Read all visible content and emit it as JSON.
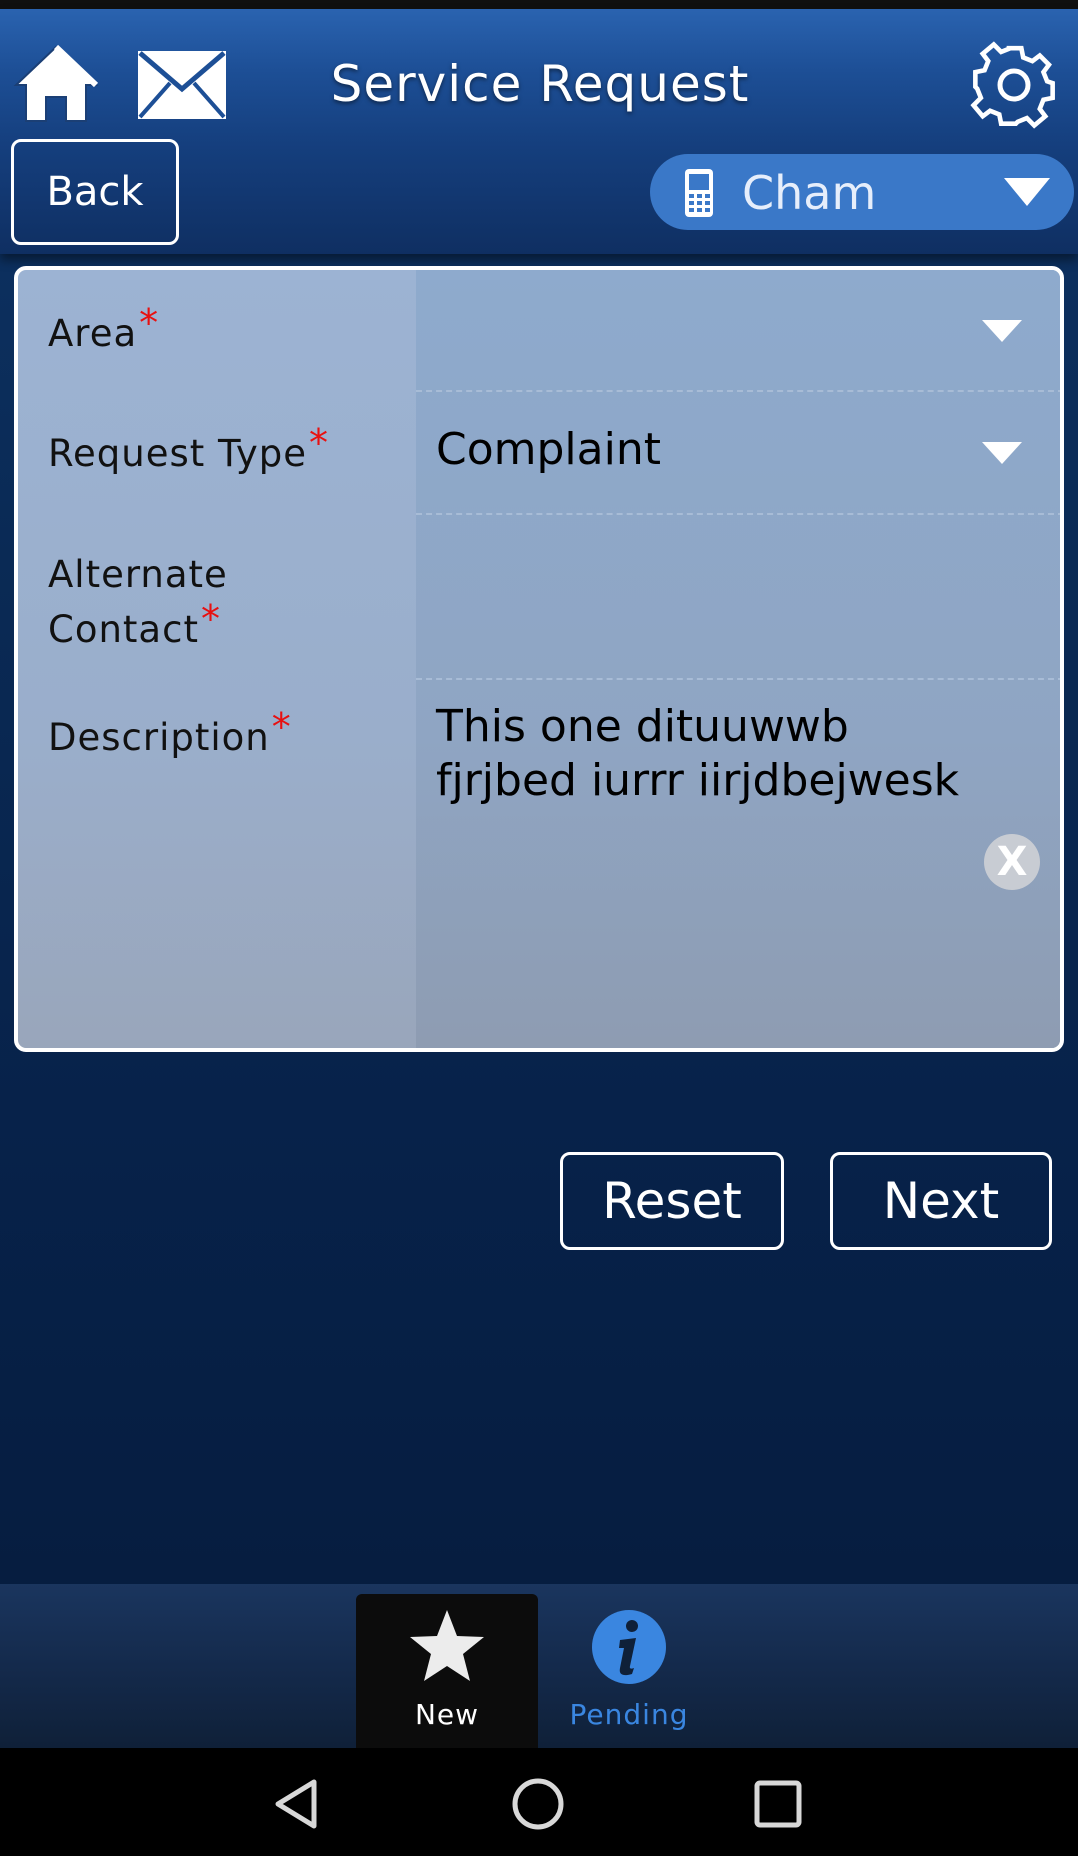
{
  "header": {
    "title": "Service Request",
    "back_label": "Back",
    "account": {
      "name": "Cham",
      "icon": "phone-icon"
    },
    "icons": [
      "home-icon",
      "mail-icon",
      "gear-icon"
    ]
  },
  "form": {
    "fields": [
      {
        "label": "Area",
        "required": true,
        "value": "",
        "type": "dropdown"
      },
      {
        "label": "Request Type",
        "required": true,
        "value": "Complaint",
        "type": "dropdown"
      },
      {
        "label_line1": "Alternate",
        "label_line2": "Contact",
        "required": true,
        "value": "",
        "type": "text"
      },
      {
        "label": "Description",
        "required": true,
        "value": "This one dituuwwb fjrjbed iurrr iirjdbejwesk",
        "type": "textarea"
      }
    ],
    "required_marker": "*",
    "clear_label": "X"
  },
  "actions": {
    "reset_label": "Reset",
    "next_label": "Next"
  },
  "tabs": [
    {
      "label": "New",
      "icon": "star-icon",
      "selected": true
    },
    {
      "label": "Pending",
      "icon": "info-icon",
      "selected": false
    }
  ],
  "colors": {
    "accent": "#3a78c8",
    "required": "#e81010",
    "tab_inactive": "#3a86e0"
  }
}
